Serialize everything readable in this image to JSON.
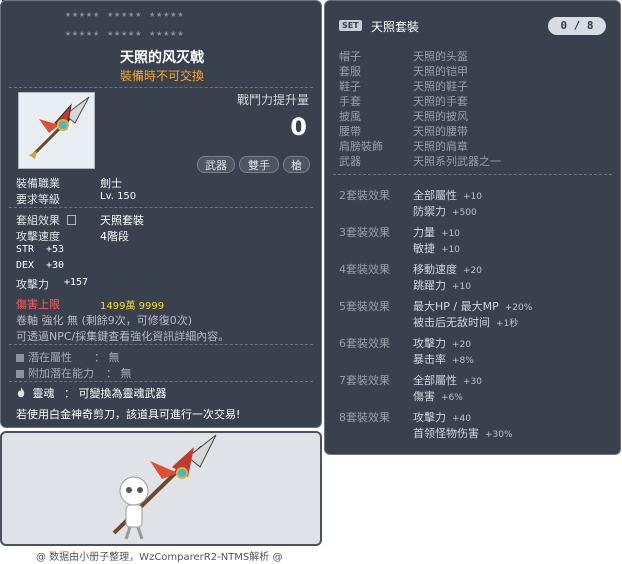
{
  "item_id": "01432140",
  "item": {
    "stars_row1": "★★★★★ ★★★★★ ★★★★★",
    "stars_row2": "★★★★★ ★★★★★ ★★★★★",
    "name": "天照的风灭戟",
    "untradeable": "裝備時不可交換",
    "power_label": "戰鬥力提升量",
    "power_value": "0",
    "tags": [
      "武器",
      "雙手",
      "槍"
    ],
    "job_label": "裝備職業",
    "job_value": "劍士",
    "level_label": "要求等級",
    "level_value": "Lv. 150",
    "set_label": "套組效果",
    "set_value": "天照套裝",
    "speed_label": "攻擊速度",
    "speed_value": "4階段",
    "str_label": "STR",
    "str_value": "+53",
    "dex_label": "DEX",
    "dex_value": "+30",
    "atk_label": "攻擊力",
    "atk_value": "+157",
    "dmgcap_label": "傷害上限",
    "dmgcap_value": "1499萬 9999",
    "scroll_text": "卷軸 強化 無 (剩餘9次，可修復0次)",
    "npc_text": "可透過NPC/採集鍵查看強化資訊詳細內容。",
    "potential_label": "潛在屬性",
    "potential_value": "： 無",
    "addpot_label": "附加潛在能力",
    "addpot_value": "： 無",
    "soul_label": "靈魂",
    "soul_value": "： 可變換為靈魂武器",
    "trade_note": "若使用白金神奇剪刀，該道具可進行一次交易!"
  },
  "set": {
    "badge": "SET",
    "title": "天照套裝",
    "count": "0 / 8",
    "slots": [
      {
        "slot": "帽子",
        "name": "天照的头盔"
      },
      {
        "slot": "套服",
        "name": "天照的铠甲"
      },
      {
        "slot": "鞋子",
        "name": "天照的鞋子"
      },
      {
        "slot": "手套",
        "name": "天照的手套"
      },
      {
        "slot": "披風",
        "name": "天照的披风"
      },
      {
        "slot": "腰帶",
        "name": "天照的腰带"
      },
      {
        "slot": "肩膀裝飾",
        "name": "天照的肩章"
      },
      {
        "slot": "武器",
        "name": "天照系列武器之一"
      }
    ],
    "effects": [
      {
        "label": "2套裝效果",
        "lines": [
          {
            "stat": "全部屬性",
            "val": "+10"
          },
          {
            "stat": "防禦力",
            "val": "+500"
          }
        ]
      },
      {
        "label": "3套裝效果",
        "lines": [
          {
            "stat": "力量",
            "val": "+10"
          },
          {
            "stat": "敏捷",
            "val": "+10"
          }
        ]
      },
      {
        "label": "4套裝效果",
        "lines": [
          {
            "stat": "移動速度",
            "val": "+20"
          },
          {
            "stat": "跳躍力",
            "val": "+10"
          }
        ]
      },
      {
        "label": "5套裝效果",
        "lines": [
          {
            "stat": "最大HP / 最大MP",
            "val": "+20%"
          },
          {
            "stat": "被击后无敌时间",
            "val": "+1秒"
          }
        ]
      },
      {
        "label": "6套裝效果",
        "lines": [
          {
            "stat": "攻擊力",
            "val": "+20"
          },
          {
            "stat": "暴击率",
            "val": "+8%"
          }
        ]
      },
      {
        "label": "7套裝效果",
        "lines": [
          {
            "stat": "全部屬性",
            "val": "+30"
          },
          {
            "stat": "傷害",
            "val": "+6%"
          }
        ]
      },
      {
        "label": "8套裝效果",
        "lines": [
          {
            "stat": "攻擊力",
            "val": "+40"
          },
          {
            "stat": "首领怪物伤害",
            "val": "+30%"
          }
        ]
      }
    ]
  },
  "footer": "@ 数据由小册子整理，WzComparerR2-NTMS解析 @",
  "colors": {
    "panel": "#38414d",
    "accent_orange": "#ffaa22",
    "damage_red": "#ff5a5a",
    "yellow": "#ffdd22"
  },
  "icons": {
    "item": "halberd-spear-icon",
    "soul": "flame-icon",
    "set": "set-badge-icon"
  }
}
